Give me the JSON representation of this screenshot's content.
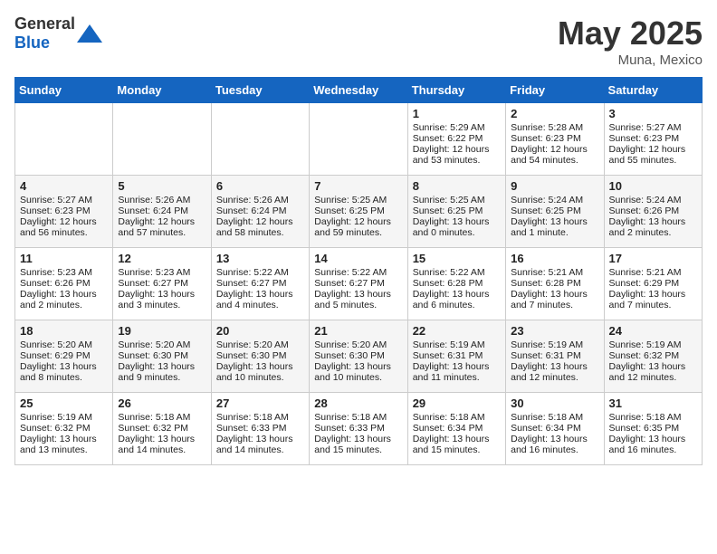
{
  "header": {
    "logo_general": "General",
    "logo_blue": "Blue",
    "title": "May 2025",
    "location": "Muna, Mexico"
  },
  "weekdays": [
    "Sunday",
    "Monday",
    "Tuesday",
    "Wednesday",
    "Thursday",
    "Friday",
    "Saturday"
  ],
  "weeks": [
    [
      {
        "day": "",
        "info": ""
      },
      {
        "day": "",
        "info": ""
      },
      {
        "day": "",
        "info": ""
      },
      {
        "day": "",
        "info": ""
      },
      {
        "day": "1",
        "info": "Sunrise: 5:29 AM\nSunset: 6:22 PM\nDaylight: 12 hours\nand 53 minutes."
      },
      {
        "day": "2",
        "info": "Sunrise: 5:28 AM\nSunset: 6:23 PM\nDaylight: 12 hours\nand 54 minutes."
      },
      {
        "day": "3",
        "info": "Sunrise: 5:27 AM\nSunset: 6:23 PM\nDaylight: 12 hours\nand 55 minutes."
      }
    ],
    [
      {
        "day": "4",
        "info": "Sunrise: 5:27 AM\nSunset: 6:23 PM\nDaylight: 12 hours\nand 56 minutes."
      },
      {
        "day": "5",
        "info": "Sunrise: 5:26 AM\nSunset: 6:24 PM\nDaylight: 12 hours\nand 57 minutes."
      },
      {
        "day": "6",
        "info": "Sunrise: 5:26 AM\nSunset: 6:24 PM\nDaylight: 12 hours\nand 58 minutes."
      },
      {
        "day": "7",
        "info": "Sunrise: 5:25 AM\nSunset: 6:25 PM\nDaylight: 12 hours\nand 59 minutes."
      },
      {
        "day": "8",
        "info": "Sunrise: 5:25 AM\nSunset: 6:25 PM\nDaylight: 13 hours\nand 0 minutes."
      },
      {
        "day": "9",
        "info": "Sunrise: 5:24 AM\nSunset: 6:25 PM\nDaylight: 13 hours\nand 1 minute."
      },
      {
        "day": "10",
        "info": "Sunrise: 5:24 AM\nSunset: 6:26 PM\nDaylight: 13 hours\nand 2 minutes."
      }
    ],
    [
      {
        "day": "11",
        "info": "Sunrise: 5:23 AM\nSunset: 6:26 PM\nDaylight: 13 hours\nand 2 minutes."
      },
      {
        "day": "12",
        "info": "Sunrise: 5:23 AM\nSunset: 6:27 PM\nDaylight: 13 hours\nand 3 minutes."
      },
      {
        "day": "13",
        "info": "Sunrise: 5:22 AM\nSunset: 6:27 PM\nDaylight: 13 hours\nand 4 minutes."
      },
      {
        "day": "14",
        "info": "Sunrise: 5:22 AM\nSunset: 6:27 PM\nDaylight: 13 hours\nand 5 minutes."
      },
      {
        "day": "15",
        "info": "Sunrise: 5:22 AM\nSunset: 6:28 PM\nDaylight: 13 hours\nand 6 minutes."
      },
      {
        "day": "16",
        "info": "Sunrise: 5:21 AM\nSunset: 6:28 PM\nDaylight: 13 hours\nand 7 minutes."
      },
      {
        "day": "17",
        "info": "Sunrise: 5:21 AM\nSunset: 6:29 PM\nDaylight: 13 hours\nand 7 minutes."
      }
    ],
    [
      {
        "day": "18",
        "info": "Sunrise: 5:20 AM\nSunset: 6:29 PM\nDaylight: 13 hours\nand 8 minutes."
      },
      {
        "day": "19",
        "info": "Sunrise: 5:20 AM\nSunset: 6:30 PM\nDaylight: 13 hours\nand 9 minutes."
      },
      {
        "day": "20",
        "info": "Sunrise: 5:20 AM\nSunset: 6:30 PM\nDaylight: 13 hours\nand 10 minutes."
      },
      {
        "day": "21",
        "info": "Sunrise: 5:20 AM\nSunset: 6:30 PM\nDaylight: 13 hours\nand 10 minutes."
      },
      {
        "day": "22",
        "info": "Sunrise: 5:19 AM\nSunset: 6:31 PM\nDaylight: 13 hours\nand 11 minutes."
      },
      {
        "day": "23",
        "info": "Sunrise: 5:19 AM\nSunset: 6:31 PM\nDaylight: 13 hours\nand 12 minutes."
      },
      {
        "day": "24",
        "info": "Sunrise: 5:19 AM\nSunset: 6:32 PM\nDaylight: 13 hours\nand 12 minutes."
      }
    ],
    [
      {
        "day": "25",
        "info": "Sunrise: 5:19 AM\nSunset: 6:32 PM\nDaylight: 13 hours\nand 13 minutes."
      },
      {
        "day": "26",
        "info": "Sunrise: 5:18 AM\nSunset: 6:32 PM\nDaylight: 13 hours\nand 14 minutes."
      },
      {
        "day": "27",
        "info": "Sunrise: 5:18 AM\nSunset: 6:33 PM\nDaylight: 13 hours\nand 14 minutes."
      },
      {
        "day": "28",
        "info": "Sunrise: 5:18 AM\nSunset: 6:33 PM\nDaylight: 13 hours\nand 15 minutes."
      },
      {
        "day": "29",
        "info": "Sunrise: 5:18 AM\nSunset: 6:34 PM\nDaylight: 13 hours\nand 15 minutes."
      },
      {
        "day": "30",
        "info": "Sunrise: 5:18 AM\nSunset: 6:34 PM\nDaylight: 13 hours\nand 16 minutes."
      },
      {
        "day": "31",
        "info": "Sunrise: 5:18 AM\nSunset: 6:35 PM\nDaylight: 13 hours\nand 16 minutes."
      }
    ]
  ]
}
